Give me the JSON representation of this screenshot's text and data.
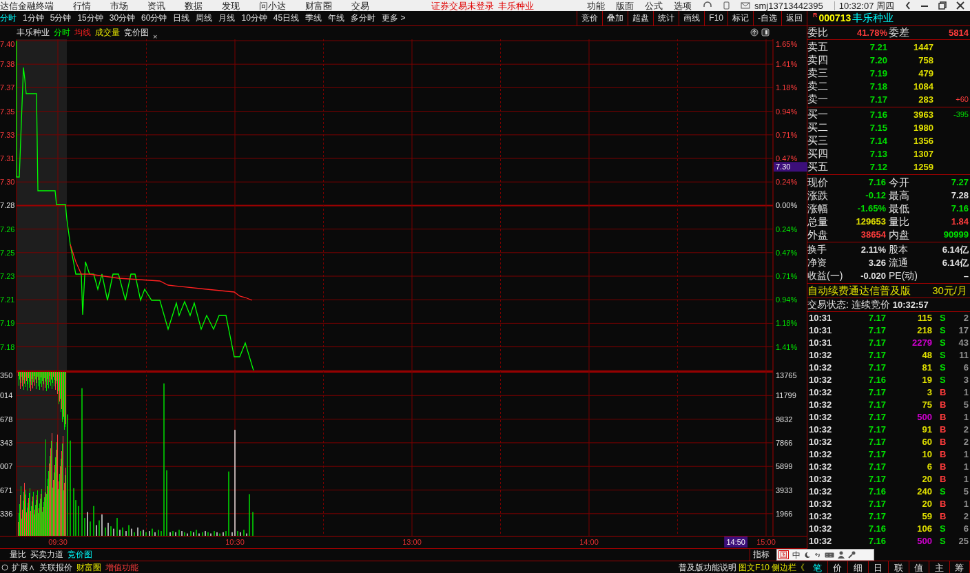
{
  "top_bar": {
    "app_title": "达信金融终端",
    "menus": [
      "行情",
      "市场",
      "资讯",
      "数据",
      "发现",
      "问小达",
      "财富圈",
      "交易"
    ],
    "login_notice": "证券交易未登录",
    "stock_name": "丰乐种业",
    "right_menus": [
      "功能",
      "版面",
      "公式",
      "选项"
    ],
    "account": "smj13713442395",
    "datetime": "10:32:07 周四"
  },
  "period_tabs": [
    {
      "label": "分时",
      "selected": true
    },
    {
      "label": "1分钟",
      "selected": false
    },
    {
      "label": "5分钟",
      "selected": false
    },
    {
      "label": "15分钟",
      "selected": false
    },
    {
      "label": "30分钟",
      "selected": false
    },
    {
      "label": "60分钟",
      "selected": false
    },
    {
      "label": "日线",
      "selected": false
    },
    {
      "label": "周线",
      "selected": false
    },
    {
      "label": "月线",
      "selected": false
    },
    {
      "label": "10分钟",
      "selected": false
    },
    {
      "label": "45日线",
      "selected": false
    },
    {
      "label": "季线",
      "selected": false
    },
    {
      "label": "年线",
      "selected": false
    },
    {
      "label": "多分时",
      "selected": false
    },
    {
      "label": "更多 >",
      "selected": false
    }
  ],
  "tools": [
    "竞价",
    "叠加",
    "超盘",
    "统计",
    "画线",
    "F10",
    "标记",
    "-自选",
    "返回"
  ],
  "chart_header": {
    "stock_name": "丰乐种业",
    "legends": [
      {
        "label": "分时",
        "kind": "price"
      },
      {
        "label": "均线",
        "kind": "average"
      },
      {
        "label": "成交量",
        "kind": "volume"
      },
      {
        "label": "竞价图",
        "kind": "plain"
      }
    ],
    "close_mark": "×"
  },
  "price_chart": {
    "cursor_price": "7.30",
    "price_ticks": [
      {
        "label": "7.40",
        "kind": "up"
      },
      {
        "label": "7.38",
        "kind": "up"
      },
      {
        "label": "7.37",
        "kind": "up"
      },
      {
        "label": "7.35",
        "kind": "up"
      },
      {
        "label": "7.33",
        "kind": "up"
      },
      {
        "label": "7.31",
        "kind": "up"
      },
      {
        "label": "7.30",
        "kind": "up"
      },
      {
        "label": "7.28",
        "kind": "flat"
      },
      {
        "label": "7.26",
        "kind": "down"
      },
      {
        "label": "7.25",
        "kind": "down"
      },
      {
        "label": "7.23",
        "kind": "down"
      },
      {
        "label": "7.21",
        "kind": "down"
      },
      {
        "label": "7.19",
        "kind": "down"
      },
      {
        "label": "7.18",
        "kind": "down"
      }
    ],
    "percent_ticks": [
      "1.65%",
      "1.41%",
      "1.18%",
      "0.94%",
      "0.71%",
      "0.47%",
      "0.24%",
      "0.00%",
      "0.24%",
      "0.47%",
      "0.71%",
      "0.94%",
      "1.18%",
      "1.41%"
    ]
  },
  "volume_chart": {
    "cursor_time": "14:50",
    "auction_ticks": [
      "350",
      "014",
      "678",
      "343",
      "007",
      "671",
      "336"
    ],
    "volume_ticks": [
      "13765",
      "11799",
      "9832",
      "7866",
      "5899",
      "3933",
      "1966"
    ],
    "time_ticks": [
      "09:30",
      "10:30",
      "13:00",
      "14:00",
      "15:00"
    ]
  },
  "bottom_tabs": [
    {
      "label": "量比",
      "selected": false
    },
    {
      "label": "买卖力道",
      "selected": false
    },
    {
      "label": "竞价图",
      "selected": true
    }
  ],
  "indicator_button": "指标",
  "footer_links": [
    {
      "label": "扩展∧",
      "kind": "plain"
    },
    {
      "label": "关联报价",
      "kind": "plain"
    },
    {
      "label": "财富圈",
      "kind": "gold"
    },
    {
      "label": "增值功能",
      "kind": "alert"
    }
  ],
  "footer_right": [
    {
      "label": "普及版功能说明",
      "kind": "plain"
    },
    {
      "label": "图文F10",
      "kind": "gold"
    },
    {
      "label": "侧边栏《",
      "kind": "gold"
    }
  ],
  "quote": {
    "market_mark": "R",
    "code": "000713",
    "name": "丰乐种业",
    "weibi": [
      {
        "label": "委比",
        "value": "41.78%"
      },
      {
        "label": "委差",
        "value": "5814"
      }
    ],
    "asks": [
      {
        "label": "卖五",
        "price": "7.21",
        "volume": "1447"
      },
      {
        "label": "卖四",
        "price": "7.20",
        "volume": "758"
      },
      {
        "label": "卖三",
        "price": "7.19",
        "volume": "479"
      },
      {
        "label": "卖二",
        "price": "7.18",
        "volume": "1084"
      },
      {
        "label": "卖一",
        "price": "7.17",
        "volume": "283",
        "change": "+60",
        "kind": "up"
      }
    ],
    "bids": [
      {
        "label": "买一",
        "price": "7.16",
        "volume": "3963",
        "change": "-395",
        "kind": "down"
      },
      {
        "label": "买二",
        "price": "7.15",
        "volume": "1980"
      },
      {
        "label": "买三",
        "price": "7.14",
        "volume": "1356"
      },
      {
        "label": "买四",
        "price": "7.13",
        "volume": "1307"
      },
      {
        "label": "买五",
        "price": "7.12",
        "volume": "1259"
      }
    ],
    "stats": [
      {
        "label": "现价",
        "value": "7.16",
        "kind": "down"
      },
      {
        "label": "今开",
        "value": "7.27",
        "kind": "down"
      },
      {
        "label": "涨跌",
        "value": "-0.12",
        "kind": "down"
      },
      {
        "label": "最高",
        "value": "7.28",
        "kind": "flat"
      },
      {
        "label": "涨幅",
        "value": "-1.65%",
        "kind": "down"
      },
      {
        "label": "最低",
        "value": "7.16",
        "kind": "down"
      },
      {
        "label": "总量",
        "value": "129653",
        "kind": "volume"
      },
      {
        "label": "量比",
        "value": "1.84",
        "kind": "up"
      },
      {
        "label": "外盘",
        "value": "38654",
        "kind": "up"
      },
      {
        "label": "内盘",
        "value": "90999",
        "kind": "down"
      }
    ],
    "info": [
      {
        "label": "换手",
        "value": "2.11%"
      },
      {
        "label": "股本",
        "value": "6.14亿"
      },
      {
        "label": "净资",
        "value": "3.26"
      },
      {
        "label": "流通",
        "value": "6.14亿"
      },
      {
        "label": "收益(一)",
        "value": "-0.020"
      },
      {
        "label": "PE(动)",
        "value": "–"
      }
    ],
    "ad": {
      "text": "自动续费通达信普及版",
      "price": "30元/月"
    },
    "status": {
      "label": "交易状态: 连续竞价",
      "time": "10:32:57"
    }
  },
  "trades": [
    {
      "time": "10:31",
      "price": "7.17",
      "volume": "115",
      "large": false,
      "side": "S",
      "count": "2"
    },
    {
      "time": "10:31",
      "price": "7.17",
      "volume": "218",
      "large": false,
      "side": "S",
      "count": "17"
    },
    {
      "time": "10:31",
      "price": "7.17",
      "volume": "2279",
      "large": true,
      "side": "S",
      "count": "43"
    },
    {
      "time": "10:32",
      "price": "7.17",
      "volume": "48",
      "large": false,
      "side": "S",
      "count": "11"
    },
    {
      "time": "10:32",
      "price": "7.17",
      "volume": "81",
      "large": false,
      "side": "S",
      "count": "6"
    },
    {
      "time": "10:32",
      "price": "7.16",
      "volume": "19",
      "large": false,
      "side": "S",
      "count": "3"
    },
    {
      "time": "10:32",
      "price": "7.17",
      "volume": "3",
      "large": false,
      "side": "B",
      "count": "1"
    },
    {
      "time": "10:32",
      "price": "7.17",
      "volume": "75",
      "large": false,
      "side": "B",
      "count": "5"
    },
    {
      "time": "10:32",
      "price": "7.17",
      "volume": "500",
      "large": true,
      "side": "B",
      "count": "1"
    },
    {
      "time": "10:32",
      "price": "7.17",
      "volume": "91",
      "large": false,
      "side": "B",
      "count": "2"
    },
    {
      "time": "10:32",
      "price": "7.17",
      "volume": "60",
      "large": false,
      "side": "B",
      "count": "2"
    },
    {
      "time": "10:32",
      "price": "7.17",
      "volume": "10",
      "large": false,
      "side": "B",
      "count": "1"
    },
    {
      "time": "10:32",
      "price": "7.17",
      "volume": "6",
      "large": false,
      "side": "B",
      "count": "1"
    },
    {
      "time": "10:32",
      "price": "7.17",
      "volume": "20",
      "large": false,
      "side": "B",
      "count": "1"
    },
    {
      "time": "10:32",
      "price": "7.16",
      "volume": "240",
      "large": false,
      "side": "S",
      "count": "5"
    },
    {
      "time": "10:32",
      "price": "7.17",
      "volume": "20",
      "large": false,
      "side": "B",
      "count": "1"
    },
    {
      "time": "10:32",
      "price": "7.17",
      "volume": "59",
      "large": false,
      "side": "B",
      "count": "2"
    },
    {
      "time": "10:32",
      "price": "7.16",
      "volume": "106",
      "large": false,
      "side": "S",
      "count": "6"
    },
    {
      "time": "10:32",
      "price": "7.16",
      "volume": "500",
      "large": true,
      "side": "S",
      "count": "25"
    }
  ],
  "ime_toolbar": {
    "labels": [
      "国",
      "中"
    ]
  },
  "right_tabs": [
    {
      "label": "笔",
      "selected": true
    },
    {
      "label": "价",
      "selected": false
    },
    {
      "label": "细",
      "selected": false
    },
    {
      "label": "日",
      "selected": false
    },
    {
      "label": "联",
      "selected": false
    },
    {
      "label": "值",
      "selected": false
    },
    {
      "label": "主",
      "selected": false
    },
    {
      "label": "筹",
      "selected": false
    }
  ]
}
